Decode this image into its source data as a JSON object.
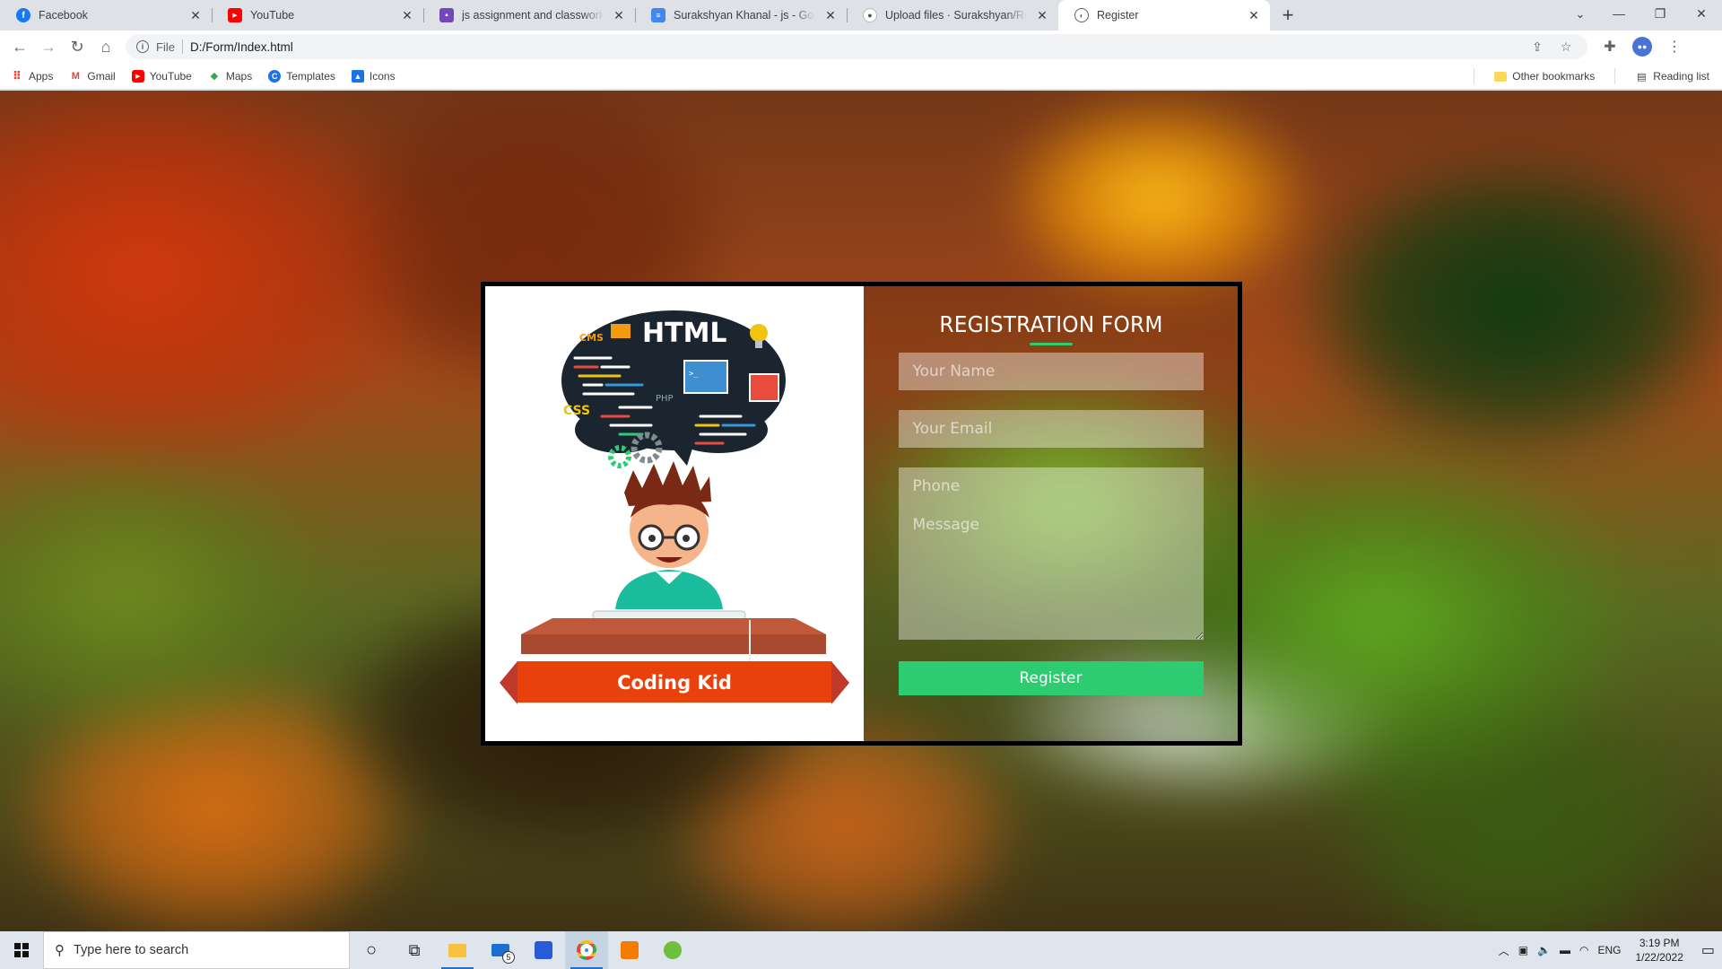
{
  "browser": {
    "tabs": [
      {
        "title": "Facebook",
        "icon": "facebook-icon",
        "color": "#1877f2"
      },
      {
        "title": "YouTube",
        "icon": "youtube-icon",
        "color": "#ff0000"
      },
      {
        "title": "js assignment and classwork submission",
        "icon": "classroom-icon",
        "color": "#7248b9"
      },
      {
        "title": "Surakshyan Khanal - js - Google Docs",
        "icon": "docs-icon",
        "color": "#4285f4"
      },
      {
        "title": "Upload files · Surakshyan/Registration",
        "icon": "github-icon",
        "color": "#24292f"
      },
      {
        "title": "Register",
        "icon": "globe-icon",
        "color": "#5f6368"
      }
    ],
    "address": {
      "scheme": "File",
      "url": "D:/Form/Index.html"
    },
    "bookmarks": [
      {
        "label": "Apps",
        "icon": "apps-grid-icon"
      },
      {
        "label": "Gmail",
        "icon": "gmail-icon"
      },
      {
        "label": "YouTube",
        "icon": "youtube-icon"
      },
      {
        "label": "Maps",
        "icon": "maps-icon"
      },
      {
        "label": "Templates",
        "icon": "templates-icon"
      },
      {
        "label": "Icons",
        "icon": "icons-icon"
      }
    ],
    "other_bookmarks": "Other bookmarks",
    "reading_list": "Reading list"
  },
  "form": {
    "title": "REGISTRATION FORM",
    "name_placeholder": "Your Name",
    "email_placeholder": "Your Email",
    "phone_placeholder": "Phone",
    "message_placeholder": "Message",
    "button": "Register",
    "accent": "#2ecc71"
  },
  "illustration": {
    "html": "HTML",
    "cms": "CMS",
    "css": "CSS",
    "php": "PHP",
    "banner": "Coding Kid"
  },
  "taskbar": {
    "search_placeholder": "Type here to search",
    "mail_badge": "5",
    "language": "ENG",
    "time": "3:19 PM",
    "date": "1/22/2022"
  }
}
